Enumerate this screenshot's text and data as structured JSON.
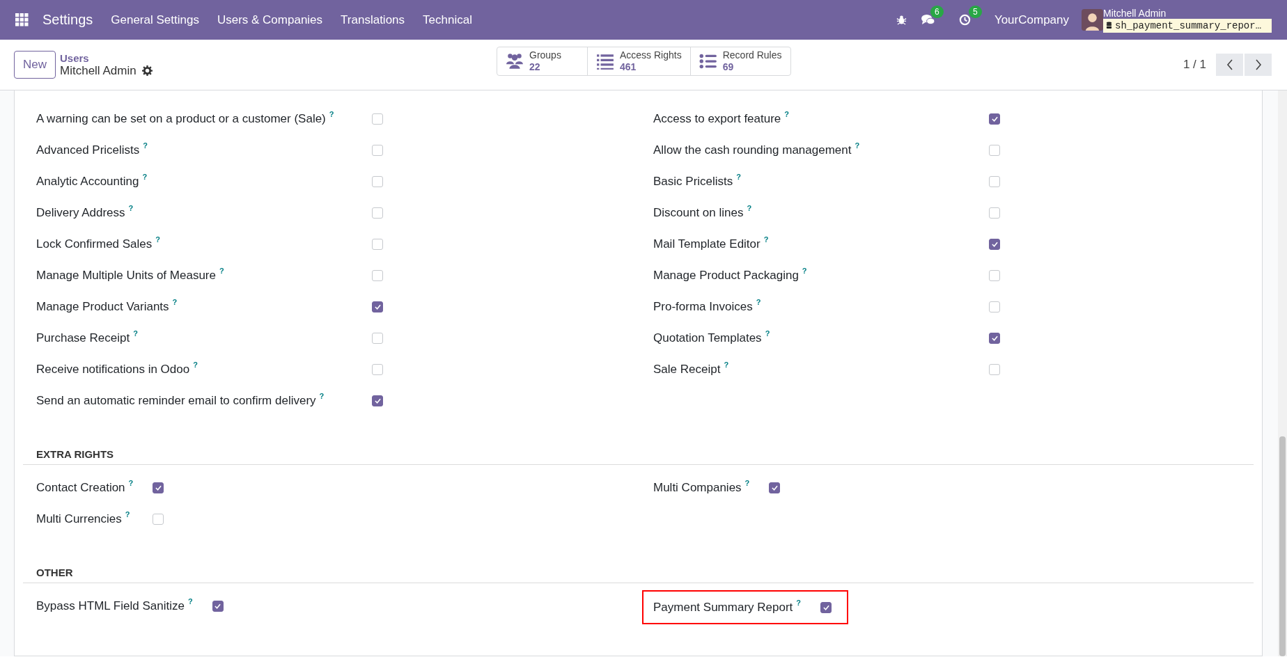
{
  "navbar": {
    "app_title": "Settings",
    "menu": [
      "General Settings",
      "Users & Companies",
      "Translations",
      "Technical"
    ],
    "chat_count": "6",
    "activity_count": "5",
    "company": "YourCompany",
    "user_name": "Mitchell Admin",
    "database": "sh_payment_summary_repor…"
  },
  "control_panel": {
    "new_button": "New",
    "breadcrumb": "Users",
    "record_title": "Mitchell Admin",
    "smart_buttons": [
      {
        "kind": "groups",
        "label": "Groups",
        "value": "22"
      },
      {
        "kind": "list",
        "label": "Access Rights",
        "value": "461"
      },
      {
        "kind": "bullets",
        "label": "Record Rules",
        "value": "69"
      }
    ],
    "pager": "1 / 1"
  },
  "sections": [
    {
      "kind": "aligned",
      "columns": [
        [
          {
            "label": "A warning can be set on a product or a customer (Sale)",
            "help": "?",
            "checked": false
          },
          {
            "label": "Advanced Pricelists",
            "help": "?",
            "checked": false
          },
          {
            "label": "Analytic Accounting",
            "help": "?",
            "checked": false
          },
          {
            "label": "Delivery Address",
            "help": "?",
            "checked": false
          },
          {
            "label": "Lock Confirmed Sales",
            "help": "?",
            "checked": false
          },
          {
            "label": "Manage Multiple Units of Measure",
            "help": "?",
            "checked": false
          },
          {
            "label": "Manage Product Variants",
            "help": "?",
            "checked": true
          },
          {
            "label": "Purchase Receipt",
            "help": "?",
            "checked": false
          },
          {
            "label": "Receive notifications in Odoo",
            "help": "?",
            "checked": false
          },
          {
            "label": "Send an automatic reminder email to confirm delivery",
            "help": "?",
            "checked": true
          }
        ],
        [
          {
            "label": "Access to export feature",
            "help": "?",
            "checked": true
          },
          {
            "label": "Allow the cash rounding management",
            "help": "?",
            "checked": false
          },
          {
            "label": "Basic Pricelists",
            "help": "?",
            "checked": false
          },
          {
            "label": "Discount on lines",
            "help": "?",
            "checked": false
          },
          {
            "label": "Mail Template Editor",
            "help": "?",
            "checked": true
          },
          {
            "label": "Manage Product Packaging",
            "help": "?",
            "checked": false
          },
          {
            "label": "Pro-forma Invoices",
            "help": "?",
            "checked": false
          },
          {
            "label": "Quotation Templates",
            "help": "?",
            "checked": true
          },
          {
            "label": "Sale Receipt",
            "help": "?",
            "checked": false
          }
        ]
      ]
    },
    {
      "kind": "inline",
      "title": "EXTRA RIGHTS",
      "columns": [
        [
          {
            "label": "Contact Creation",
            "help": "?",
            "checked": true
          },
          {
            "label": "Multi Currencies",
            "help": "?",
            "checked": false
          }
        ],
        [
          {
            "label": "Multi Companies",
            "help": "?",
            "checked": true
          }
        ]
      ]
    },
    {
      "kind": "inline",
      "title": "OTHER",
      "columns": [
        [
          {
            "label": "Bypass HTML Field Sanitize",
            "help": "?",
            "checked": true
          }
        ],
        [
          {
            "label": "Payment Summary Report",
            "help": "?",
            "checked": true,
            "highlighted": true
          }
        ]
      ]
    }
  ]
}
